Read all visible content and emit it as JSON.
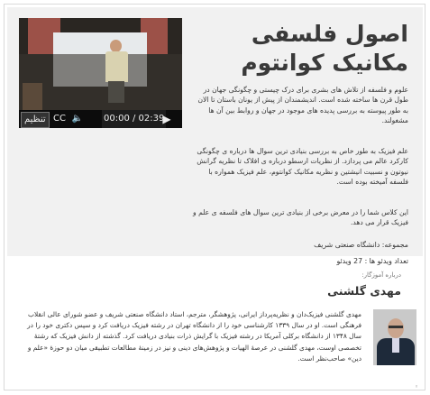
{
  "course": {
    "title_line1": "اصول فلسفی",
    "title_line2": "مکانیک کوانتوم",
    "description": [
      "علوم و فلسفه از تلاش های بشری برای درک چیستی و چگونگی جهان در طول قرن ها ساخته شده است. اندیشمندان از پیش از یونان باستان تا الان به طور پیوسته به بررسی پدیده های موجود در جهان و روابط بین آن ها مشغولند.",
      "علم فیزیک به طور خاص به بررسی بنیادی ترین سوال ها درباره ی چگونگی کارکرد عالم می پردازد. از نظریات ارسطو درباره ی افلاک تا نظریه گرانش نیوتون و نسبیت انیشتین و نظریه مکانیک کوانتوم، علم فیزیک همواره با فلسفه آمیخته بوده است.",
      "این کلاس شما را در معرض برخی از بنیادی ترین سوال های فلسفه ی علم و فیزیک قرار می دهد."
    ],
    "collection_label": "مجموعه:",
    "collection_value": "دانشگاه صنعتی شریف",
    "video_count_label": "تعداد ویدئو ها :",
    "video_count_value": "27 ویدئو"
  },
  "player": {
    "subtitles_label": "تنظیم",
    "time_display": "00:00 / 02:39",
    "cc_icon": "CC",
    "volume_icon": "speaker-icon",
    "play_icon": "play-icon"
  },
  "teacher": {
    "caption": "درباره آموزگار:",
    "name": "مهدی گلشنی",
    "bio": "مهدی گلشنی فیزیک‌دان و نظریه‌پرداز ایرانی، پژوهشگر، مترجم، استاد دانشگاه صنعتی شریف و عضو شورای عالی انقلاب فرهنگی است. او در سال ۱۳۳۹ کارشناسی خود را از دانشگاه تهران در رشته فیزیک دریافت کرد و سپس دکتری خود را در سال ۱۳۴۸ از دانشگاه برکلی آمریکا در رشته فیزیک با گرایش ذرات بنیادی دریافت کرد. گذشته از دانش فیزیک که رشتهٔ تخصصی اوست، مهدی گلشنی در عرصهٔ الهیات و پژوهش‌های دینی و نیز در زمینهٔ مطالعات تطبیقی میان دو حوزهٔ «علم و دین» صاحب‌نظر است."
  },
  "footer": {
    "mark": "◦"
  },
  "colors": {
    "panel": "#f1f1f1",
    "title": "#3a3a3a",
    "player_bar": "#0c0c0c"
  }
}
